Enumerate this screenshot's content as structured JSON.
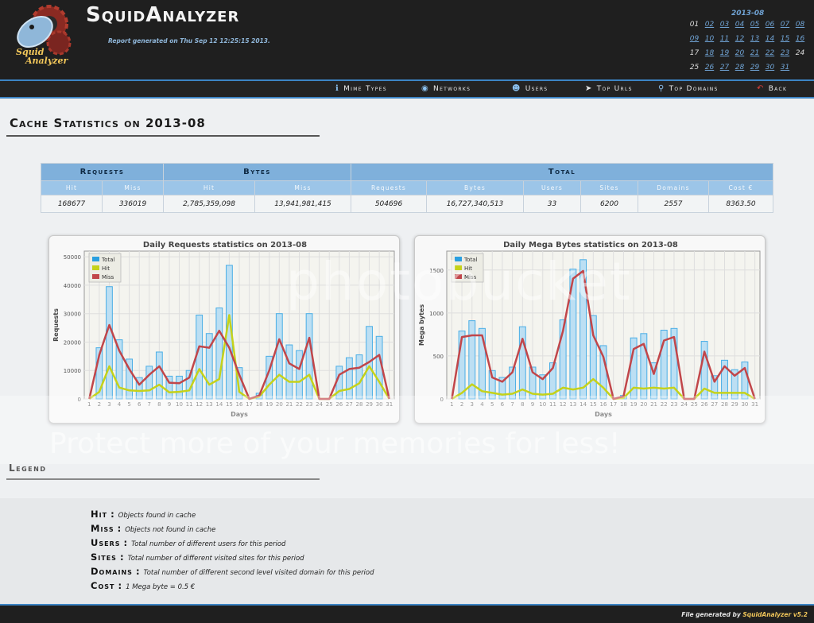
{
  "app": {
    "title": "SquidAnalyzer",
    "logo_text_1": "Squid",
    "logo_text_2": "Analyzer",
    "report_generated": "Report generated on Thu Sep 12 12:25:15 2013."
  },
  "calendar": {
    "title": "2013-08",
    "days": [
      {
        "d": "01",
        "link": false
      },
      {
        "d": "02",
        "link": true
      },
      {
        "d": "03",
        "link": true
      },
      {
        "d": "04",
        "link": true
      },
      {
        "d": "05",
        "link": true
      },
      {
        "d": "06",
        "link": true
      },
      {
        "d": "07",
        "link": true
      },
      {
        "d": "08",
        "link": true
      },
      {
        "d": "09",
        "link": true
      },
      {
        "d": "10",
        "link": true
      },
      {
        "d": "11",
        "link": true
      },
      {
        "d": "12",
        "link": true
      },
      {
        "d": "13",
        "link": true
      },
      {
        "d": "14",
        "link": true
      },
      {
        "d": "15",
        "link": true
      },
      {
        "d": "16",
        "link": true
      },
      {
        "d": "17",
        "link": false
      },
      {
        "d": "18",
        "link": true
      },
      {
        "d": "19",
        "link": true
      },
      {
        "d": "20",
        "link": true
      },
      {
        "d": "21",
        "link": true
      },
      {
        "d": "22",
        "link": true
      },
      {
        "d": "23",
        "link": true
      },
      {
        "d": "24",
        "link": false
      },
      {
        "d": "25",
        "link": false
      },
      {
        "d": "26",
        "link": true
      },
      {
        "d": "27",
        "link": true
      },
      {
        "d": "28",
        "link": true
      },
      {
        "d": "29",
        "link": true
      },
      {
        "d": "30",
        "link": true
      },
      {
        "d": "31",
        "link": true
      }
    ]
  },
  "nav": {
    "mime_types": "Mime Types",
    "networks": "Networks",
    "users": "Users",
    "top_urls": "Top Urls",
    "top_domains": "Top Domains",
    "back": "Back"
  },
  "page_title": "Cache Statistics on 2013-08",
  "stats_table": {
    "groups": {
      "requests": "Requests",
      "bytes": "Bytes",
      "total": "Total"
    },
    "columns": [
      "Hit",
      "Miss",
      "Hit",
      "Miss",
      "Requests",
      "Bytes",
      "Users",
      "Sites",
      "Domains",
      "Cost €"
    ],
    "values": [
      "168677",
      "336019",
      "2,785,359,098",
      "13,941,981,415",
      "504696",
      "16,727,340,513",
      "33",
      "6200",
      "2557",
      "8363.50"
    ]
  },
  "legend": {
    "heading": "Legend",
    "items": [
      {
        "term": "Hit",
        "desc": "Objects found in cache"
      },
      {
        "term": "Miss",
        "desc": "Objects not found in cache"
      },
      {
        "term": "Users",
        "desc": "Total number of different users for this period"
      },
      {
        "term": "Sites",
        "desc": "Total number of different visited sites for this period"
      },
      {
        "term": "Domains",
        "desc": "Total number of different second level visited domain for this period"
      },
      {
        "term": "Cost",
        "desc": "1 Mega byte = 0.5 €"
      }
    ]
  },
  "footer": {
    "prefix": "File generated by ",
    "brand": "SquidAnalyzer v5.2"
  },
  "watermark": {
    "line1": "photobucket",
    "line2": "Protect more of your memories for less!"
  },
  "colors": {
    "total": "#2a9fe0",
    "hit": "#c5d21a",
    "miss": "#c1464a",
    "header_bg": "#1f1f1f",
    "accent": "#3c84c4"
  },
  "chart_data": [
    {
      "type": "bar",
      "title": "Daily Requests statistics on 2013-08",
      "xlabel": "Days",
      "ylabel": "Requests",
      "ylim": [
        0,
        52000
      ],
      "yticks": [
        0,
        10000,
        20000,
        30000,
        40000,
        50000
      ],
      "grid": true,
      "legend": "top-left",
      "categories": [
        "1",
        "2",
        "3",
        "4",
        "5",
        "6",
        "7",
        "8",
        "9",
        "10",
        "11",
        "12",
        "13",
        "14",
        "15",
        "16",
        "17",
        "18",
        "19",
        "20",
        "21",
        "22",
        "23",
        "24",
        "25",
        "26",
        "27",
        "28",
        "29",
        "30",
        "31"
      ],
      "series": [
        {
          "name": "Total",
          "render": "bar",
          "values": [
            0,
            18000,
            39500,
            20800,
            14000,
            7500,
            11500,
            16500,
            8000,
            8000,
            10000,
            29500,
            23000,
            32000,
            47000,
            11000,
            0,
            2000,
            15000,
            30000,
            19000,
            17000,
            30000,
            0,
            0,
            11500,
            14500,
            15500,
            25500,
            22000,
            0
          ]
        },
        {
          "name": "Hit",
          "render": "line",
          "values": [
            0,
            2500,
            11500,
            4000,
            3000,
            2800,
            3000,
            5000,
            2300,
            2500,
            3000,
            10500,
            5000,
            7000,
            29500,
            2500,
            0,
            800,
            5000,
            8500,
            6000,
            6000,
            8500,
            0,
            0,
            2800,
            3500,
            5500,
            11500,
            6000,
            0
          ]
        },
        {
          "name": "Miss",
          "render": "line",
          "values": [
            0,
            15500,
            26000,
            17000,
            10500,
            5000,
            8500,
            11500,
            5700,
            5500,
            7500,
            18500,
            18000,
            24000,
            18000,
            8500,
            0,
            1200,
            10000,
            21000,
            12500,
            10500,
            21500,
            0,
            0,
            8500,
            10500,
            11000,
            13000,
            15500,
            0
          ]
        }
      ]
    },
    {
      "type": "bar",
      "title": "Daily Mega Bytes statistics on 2013-08",
      "xlabel": "Days",
      "ylabel": "Mega bytes",
      "ylim": [
        0,
        1720
      ],
      "yticks": [
        0,
        500,
        1000,
        1500
      ],
      "grid": true,
      "legend": "top-left",
      "categories": [
        "1",
        "2",
        "3",
        "4",
        "5",
        "6",
        "7",
        "8",
        "9",
        "10",
        "11",
        "12",
        "13",
        "14",
        "15",
        "16",
        "17",
        "18",
        "19",
        "20",
        "21",
        "22",
        "23",
        "24",
        "25",
        "26",
        "27",
        "28",
        "29",
        "30",
        "31"
      ],
      "series": [
        {
          "name": "Total",
          "render": "bar",
          "values": [
            0,
            790,
            910,
            820,
            330,
            250,
            370,
            840,
            370,
            280,
            420,
            920,
            1510,
            1620,
            970,
            620,
            0,
            40,
            710,
            760,
            420,
            800,
            820,
            0,
            0,
            670,
            270,
            450,
            340,
            430,
            0
          ]
        },
        {
          "name": "Hit",
          "render": "line",
          "values": [
            0,
            70,
            170,
            90,
            70,
            50,
            60,
            110,
            60,
            50,
            60,
            130,
            110,
            130,
            230,
            130,
            0,
            10,
            130,
            120,
            130,
            120,
            130,
            0,
            0,
            120,
            70,
            70,
            70,
            70,
            0
          ]
        },
        {
          "name": "Miss",
          "render": "line",
          "values": [
            0,
            720,
            740,
            740,
            250,
            200,
            310,
            700,
            310,
            230,
            360,
            790,
            1400,
            1490,
            740,
            490,
            0,
            30,
            580,
            640,
            290,
            680,
            720,
            0,
            0,
            550,
            200,
            380,
            270,
            360,
            0
          ]
        }
      ]
    }
  ]
}
